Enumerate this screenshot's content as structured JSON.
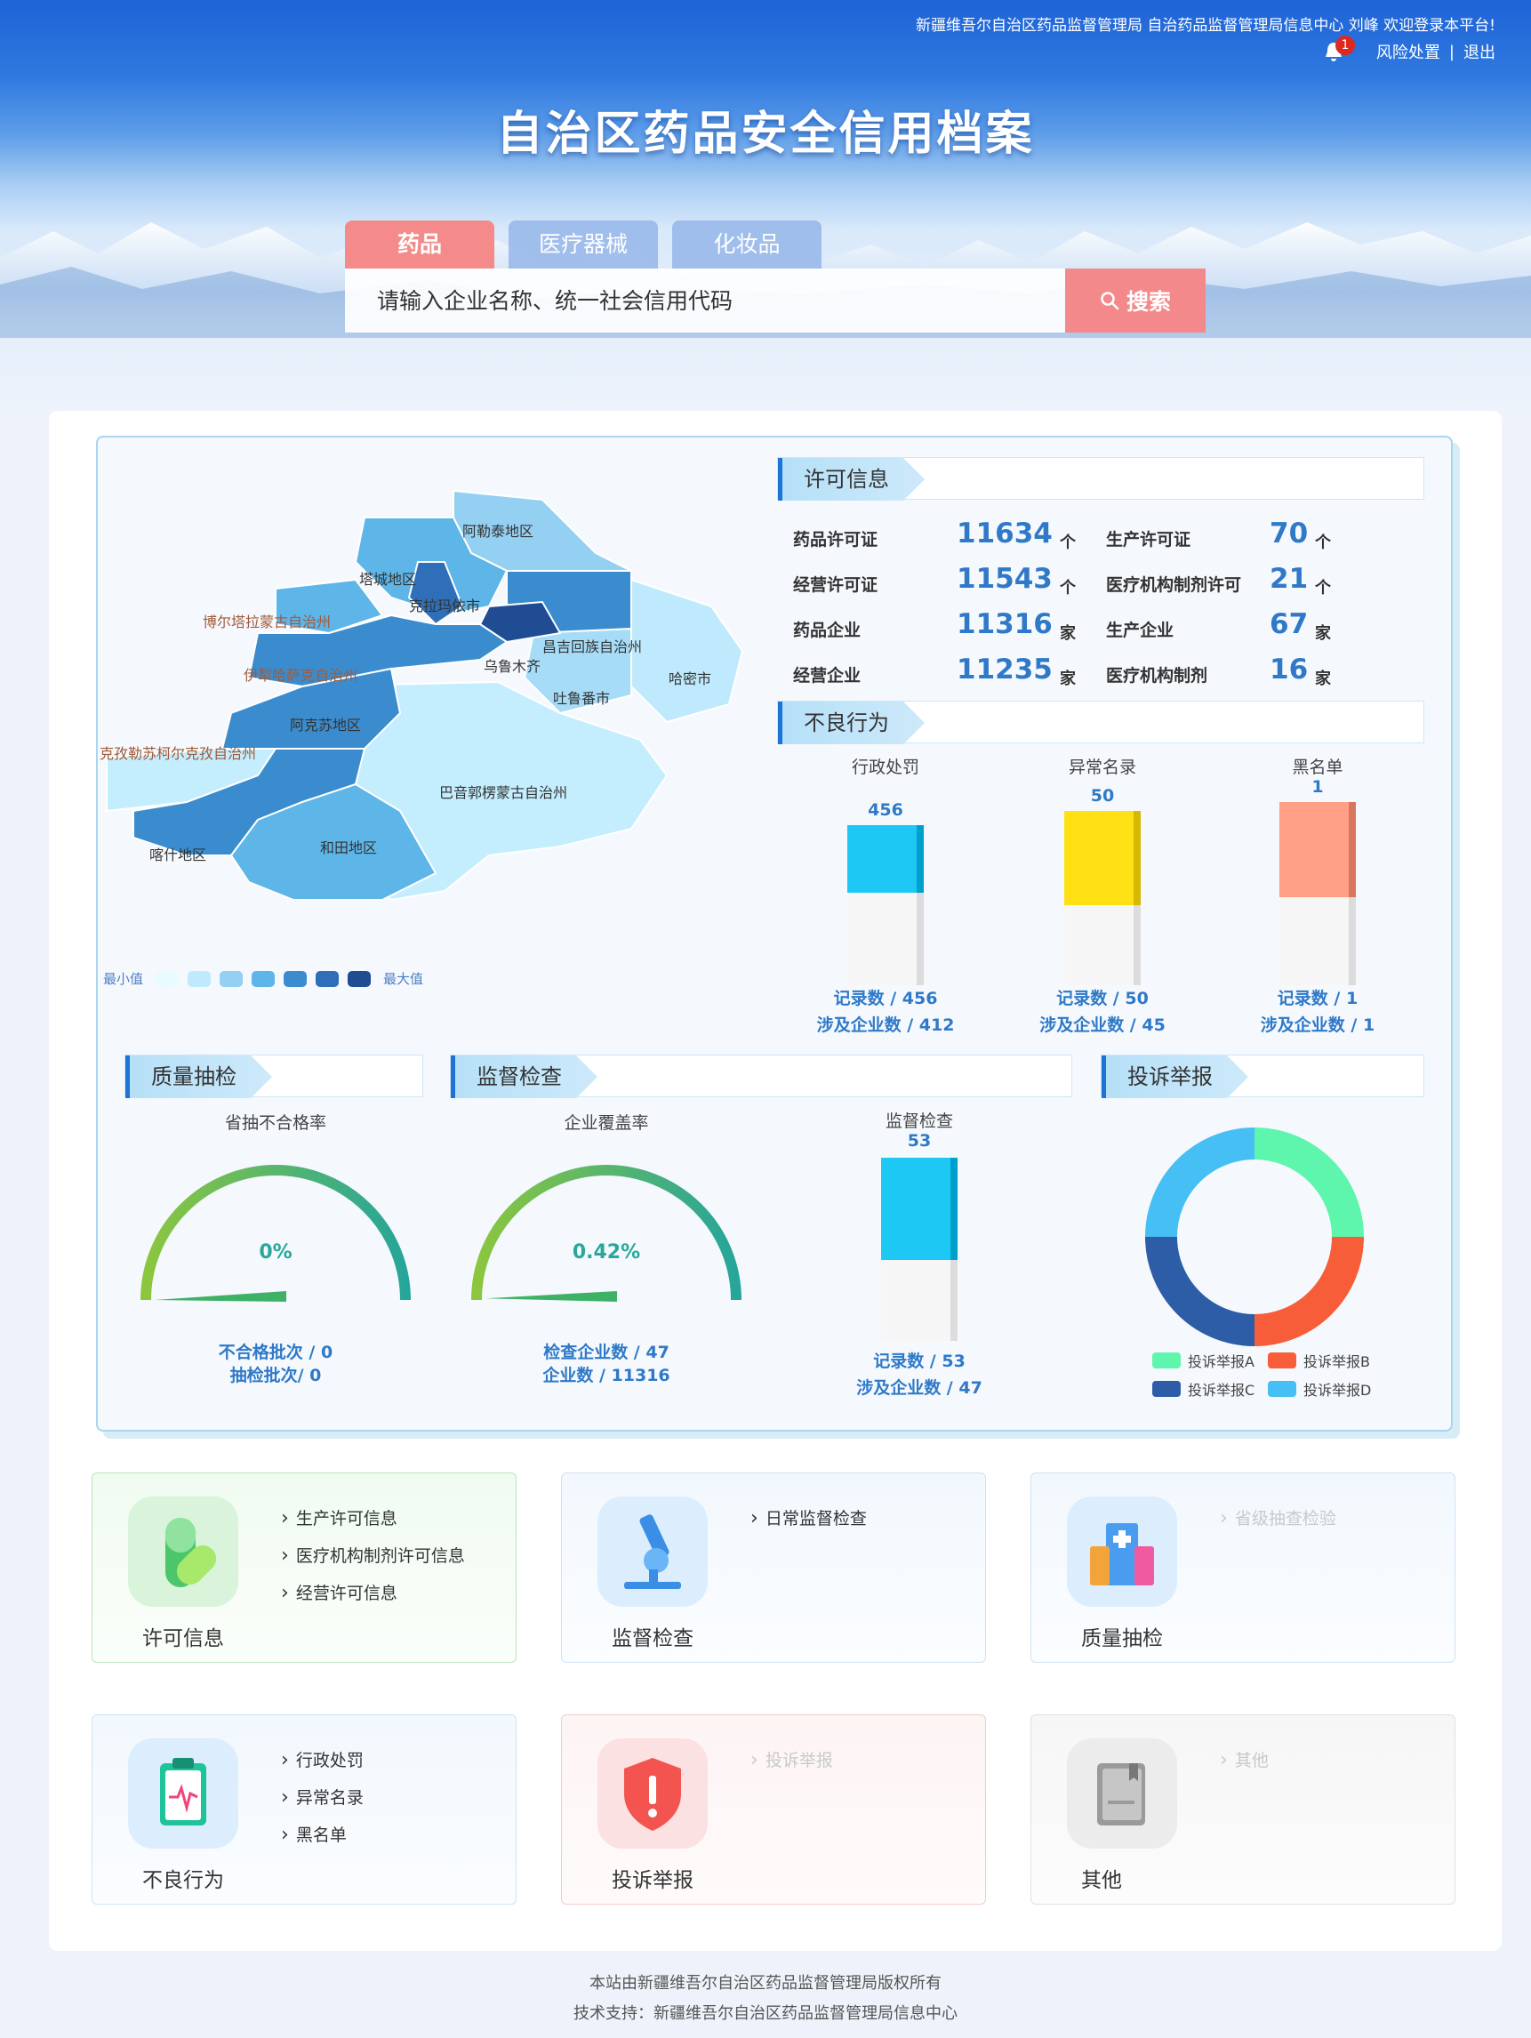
{
  "header": {
    "top_info": "新疆维吾尔自治区药品监督管理局  自治药品监督管理局信息中心  刘峰  欢迎登录本平台!",
    "notification_count": "1",
    "risk_link": "风险处置",
    "separator": "|",
    "logout": "退出",
    "site_title": "自治区药品安全信用档案"
  },
  "tabs": [
    {
      "label": "药品"
    },
    {
      "label": "医疗器械"
    },
    {
      "label": "化妆品"
    }
  ],
  "search": {
    "placeholder": "请输入企业名称、统一社会信用代码",
    "button": "搜索"
  },
  "map": {
    "regions": [
      "阿勒泰地区",
      "塔城地区",
      "克拉玛依市",
      "博尔塔拉蒙古自治州",
      "伊犁哈萨克自治州",
      "乌鲁木齐",
      "昌吉回族自治州",
      "哈密市",
      "吐鲁番市",
      "阿克苏地区",
      "克孜勒苏柯尔克孜自治州",
      "巴音郭楞蒙古自治州",
      "喀什地区",
      "和田地区"
    ],
    "legend_min": "最小值",
    "legend_max": "最大值",
    "scale_colors": [
      "#e8fbff",
      "#bfeafd",
      "#93d0f2",
      "#5db5e8",
      "#3b8cce",
      "#2f6eb8",
      "#1f4c93"
    ]
  },
  "license": {
    "title": "许可信息",
    "items": [
      {
        "label": "药品许可证",
        "value": "11634",
        "unit": "个"
      },
      {
        "label": "生产许可证",
        "value": "70",
        "unit": "个"
      },
      {
        "label": "经营许可证",
        "value": "11543",
        "unit": "个"
      },
      {
        "label": "医疗机构制剂许可",
        "value": "21",
        "unit": "个"
      },
      {
        "label": "药品企业",
        "value": "11316",
        "unit": "家"
      },
      {
        "label": "生产企业",
        "value": "67",
        "unit": "家"
      },
      {
        "label": "经营企业",
        "value": "11235",
        "unit": "家"
      },
      {
        "label": "医疗机构制剂",
        "value": "16",
        "unit": "家"
      }
    ]
  },
  "bad_behavior": {
    "title": "不良行为",
    "bars": [
      {
        "name": "行政处罚",
        "value": "456",
        "fraction": 0.42,
        "color": "#1ec8f5",
        "records": "记录数 / 456",
        "companies": "涉及企业数 / 412"
      },
      {
        "name": "异常名录",
        "value": "50",
        "fraction": 0.54,
        "color": "#ffe014",
        "records": "记录数 / 50",
        "companies": "涉及企业数 / 45"
      },
      {
        "name": "黑名单",
        "value": "1",
        "fraction": 0.52,
        "color": "#ff9f85",
        "records": "记录数 / 1",
        "companies": "涉及企业数 / 1"
      }
    ]
  },
  "quality": {
    "title": "质量抽检",
    "gauge_title": "省抽不合格率",
    "gauge_value": "0%",
    "gauge_fraction": 0.0,
    "stat1": "不合格批次 / 0",
    "stat2": "抽检批次/ 0"
  },
  "supervision": {
    "title": "监督检查",
    "gauge_title": "企业覆盖率",
    "gauge_value": "0.42%",
    "gauge_fraction": 0.0042,
    "stat1": "检查企业数 / 47",
    "stat2": "企业数 / 11316",
    "bar_title": "监督检查",
    "bar_value": "53",
    "bar_fraction": 0.56,
    "bar_color": "#1ec8f5",
    "bar_records": "记录数 / 53",
    "bar_companies": "涉及企业数 / 47"
  },
  "complaint": {
    "title": "投诉举报",
    "slices": [
      {
        "name": "投诉举报A",
        "value": 25,
        "color": "#5ef5ad"
      },
      {
        "name": "投诉举报B",
        "value": 25,
        "color": "#f75d39"
      },
      {
        "name": "投诉举报C",
        "value": 25,
        "color": "#2d5da6"
      },
      {
        "name": "投诉举报D",
        "value": 25,
        "color": "#46bff4"
      }
    ]
  },
  "nav_cards": [
    {
      "title": "许可信息",
      "links": [
        "生产许可信息",
        "医疗机构制剂许可信息",
        "经营许可信息"
      ]
    },
    {
      "title": "监督检查",
      "links": [
        "日常监督检查"
      ]
    },
    {
      "title": "质量抽检",
      "links": [
        "省级抽查检验"
      ]
    },
    {
      "title": "不良行为",
      "links": [
        "行政处罚",
        "异常名录",
        "黑名单"
      ]
    },
    {
      "title": "投诉举报",
      "links": [
        "投诉举报"
      ]
    },
    {
      "title": "其他",
      "links": [
        "其他"
      ]
    }
  ],
  "footer": {
    "line1": "本站由新疆维吾尔自治区药品监督管理局版权所有",
    "line2": "技术支持：新疆维吾尔自治区药品监督管理局信息中心"
  }
}
